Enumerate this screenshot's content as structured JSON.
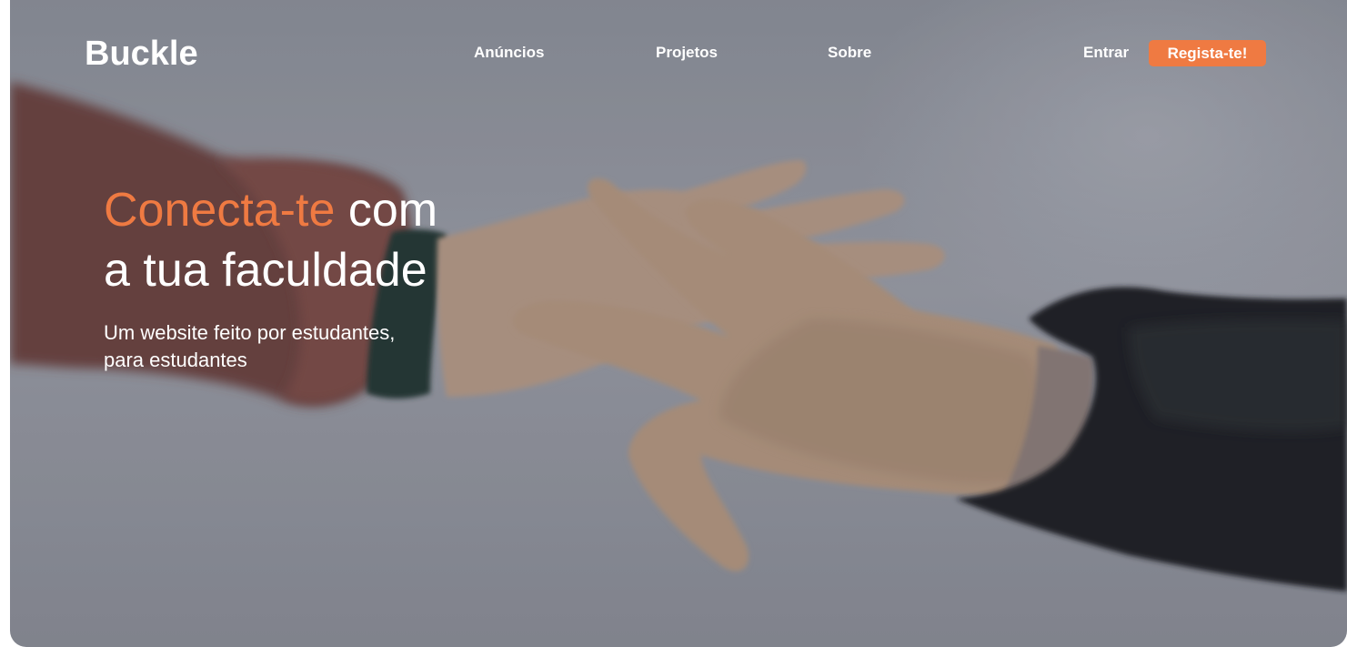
{
  "brand": {
    "name": "Buckle",
    "accent_color": "#ef7a42"
  },
  "nav": {
    "links": [
      {
        "label": "Anúncios"
      },
      {
        "label": "Projetos"
      },
      {
        "label": "Sobre"
      }
    ],
    "login_label": "Entrar",
    "register_label": "Regista-te!"
  },
  "hero": {
    "title_accent": "Conecta-te",
    "title_rest_line1": " com",
    "title_line2": "a tua faculdade",
    "subtitle_line1": "Um website feito por estudantes,",
    "subtitle_line2": "para estudantes",
    "background_image": "hands-reaching-photo"
  }
}
